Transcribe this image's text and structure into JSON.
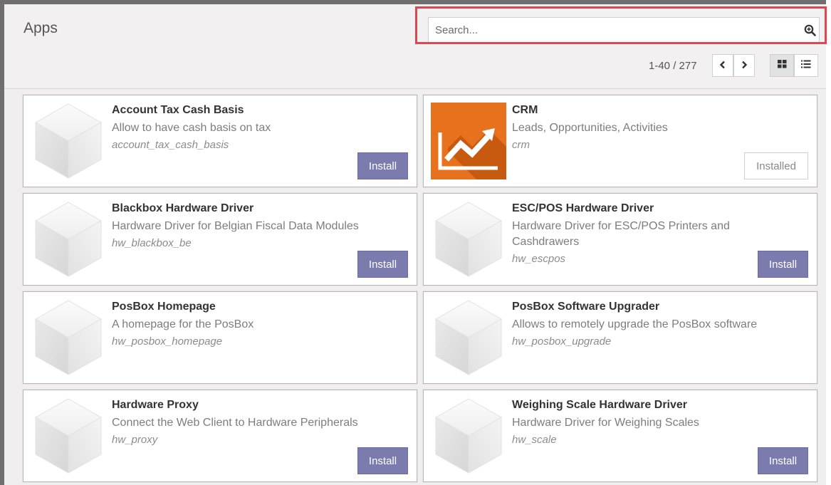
{
  "breadcrumb": "Apps",
  "search": {
    "placeholder": "Search..."
  },
  "pager": {
    "value": "1-40 / 277"
  },
  "colors": {
    "accent": "#7c7bad",
    "highlight": "#e0464f",
    "crm_orange": "#e8711d"
  },
  "modules": [
    {
      "name": "Account Tax Cash Basis",
      "summary": "Allow to have cash basis on tax",
      "technical": "account_tax_cash_basis",
      "action": "Install",
      "icon": "cube-icon"
    },
    {
      "name": "CRM",
      "summary": "Leads, Opportunities, Activities",
      "technical": "crm",
      "action": "Installed",
      "icon": "crm-chart-icon"
    },
    {
      "name": "Blackbox Hardware Driver",
      "summary": "Hardware Driver for Belgian Fiscal Data Modules",
      "technical": "hw_blackbox_be",
      "action": "Install",
      "icon": "cube-icon"
    },
    {
      "name": "ESC/POS Hardware Driver",
      "summary": "Hardware Driver for ESC/POS Printers and Cashdrawers",
      "technical": "hw_escpos",
      "action": "Install",
      "icon": "cube-icon"
    },
    {
      "name": "PosBox Homepage",
      "summary": "A homepage for the PosBox",
      "technical": "hw_posbox_homepage",
      "action": "",
      "icon": "cube-icon"
    },
    {
      "name": "PosBox Software Upgrader",
      "summary": "Allows to remotely upgrade the PosBox software",
      "technical": "hw_posbox_upgrade",
      "action": "",
      "icon": "cube-icon"
    },
    {
      "name": "Hardware Proxy",
      "summary": "Connect the Web Client to Hardware Peripherals",
      "technical": "hw_proxy",
      "action": "Install",
      "icon": "cube-icon"
    },
    {
      "name": "Weighing Scale Hardware Driver",
      "summary": "Hardware Driver for Weighing Scales",
      "technical": "hw_scale",
      "action": "Install",
      "icon": "cube-icon"
    }
  ]
}
